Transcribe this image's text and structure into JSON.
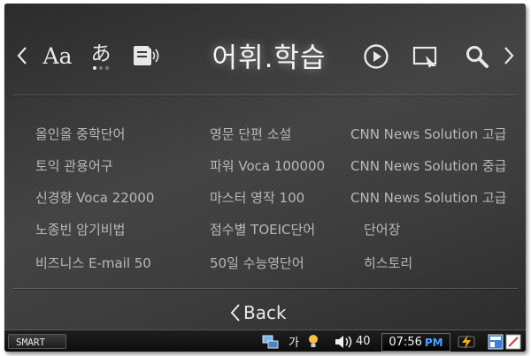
{
  "header": {
    "title": "어휘.학습",
    "font_icon_label": "Aa",
    "kana_icon_label": "あ",
    "icons": [
      "chevron-left-icon",
      "font-size-icon",
      "japanese-char-icon",
      "speech-sound-icon",
      "play-icon",
      "window-icon",
      "search-icon",
      "chevron-right-icon"
    ]
  },
  "word_lists": [
    {
      "label": "올인올 중학단어"
    },
    {
      "label": "토익 관용어구"
    },
    {
      "label": "신경향 Voca 22000"
    },
    {
      "label": "노종빈 암기비법"
    },
    {
      "label": "비즈니스 E-mail 50"
    },
    {
      "label": "영문 단편 소설"
    },
    {
      "label": "파워 Voca 100000"
    },
    {
      "label": "마스터 영작 100"
    },
    {
      "label": "점수별 TOEIC단어"
    },
    {
      "label": "50일 수능영단어"
    },
    {
      "label": "CNN News Solution 고급"
    },
    {
      "label": "CNN News Solution 중급"
    },
    {
      "label": "CNN News Solution 고급"
    },
    {
      "label": "단어장"
    },
    {
      "label": "히스토리"
    }
  ],
  "footer": {
    "back_label": "Back"
  },
  "taskbar": {
    "start_label": "SMART",
    "ime_label": "가",
    "volume_value": "40",
    "time": "07:56",
    "ampm": "PM",
    "accent_color": "#4aa3ff"
  }
}
